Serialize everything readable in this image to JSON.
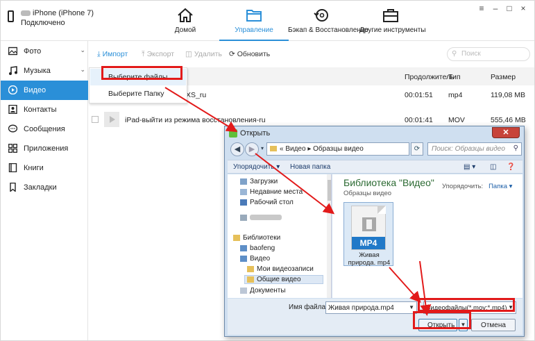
{
  "device": {
    "name": "iPhone (iPhone 7)",
    "status": "Подключено"
  },
  "nav_tabs": [
    {
      "label": "Домой",
      "icon": "home-icon"
    },
    {
      "label": "Управление",
      "icon": "folder-icon",
      "active": true
    },
    {
      "label": "Бэкап & Восстановление",
      "icon": "backup-icon"
    },
    {
      "label": "Другие инструменты",
      "icon": "toolbox-icon"
    }
  ],
  "window_controls": [
    "≡",
    "–",
    "□",
    "×"
  ],
  "sidebar": {
    "items": [
      {
        "label": "Фото",
        "icon": "photo-icon",
        "has_arrow": true
      },
      {
        "label": "Музыка",
        "icon": "music-icon",
        "has_arrow": true
      },
      {
        "label": "Видео",
        "icon": "video-icon",
        "active": true
      },
      {
        "label": "Контакты",
        "icon": "contacts-icon"
      },
      {
        "label": "Сообщения",
        "icon": "messages-icon"
      },
      {
        "label": "Приложения",
        "icon": "apps-icon"
      },
      {
        "label": "Книги",
        "icon": "books-icon"
      },
      {
        "label": "Закладки",
        "icon": "bookmarks-icon"
      }
    ]
  },
  "toolbar": {
    "import": "Импорт",
    "export": "Экспорт",
    "delete": "Удалить",
    "refresh": "Обновить",
    "search_placeholder": "Поиск"
  },
  "table": {
    "headers": {
      "duration": "Продолжитель",
      "type": "Тип",
      "size": "Размер"
    },
    "rows": [
      {
        "name": "XS_ru",
        "duration": "00:01:51",
        "type": "mp4",
        "size": "119,08 MB"
      },
      {
        "name": "iPad-выйти из режима восстановления-ru",
        "duration": "00:01:41",
        "type": "MOV",
        "size": "555,46 MB"
      }
    ]
  },
  "import_menu": {
    "option1": "Выберите файлы",
    "option2": "Выберите Папку"
  },
  "dialog": {
    "title": "Открыть",
    "close": "✕",
    "path": "«  Видео  ▸  Образцы видео",
    "search_placeholder": "Поиск: Образцы видео",
    "organize": "Упорядочить ▾",
    "new_folder": "Новая папка",
    "tree": [
      {
        "label": "Загрузки",
        "icon": "downloads-icon"
      },
      {
        "label": "Недавние места",
        "icon": "recent-places-icon"
      },
      {
        "label": "Рабочий стол",
        "icon": "desktop-icon"
      },
      {
        "label": "Библиотеки",
        "icon": "libraries-icon"
      },
      {
        "label": "baofeng",
        "icon": "library-icon"
      },
      {
        "label": "Видео",
        "icon": "video-library-icon"
      },
      {
        "label": "Мои видеозаписи",
        "icon": "folder-icon"
      },
      {
        "label": "Общие видео",
        "icon": "folder-icon",
        "selected": true
      },
      {
        "label": "Документы",
        "icon": "documents-icon"
      }
    ],
    "library_title": "Библиотека \"Видео\"",
    "library_subtitle": "Образцы видео",
    "arrange_label": "Упорядочить:",
    "arrange_value": "Папка ▾",
    "file": {
      "badge": "MP4",
      "name": "Живая природа. mp4"
    },
    "filename_label": "Имя файла:",
    "filename_value": "Живая природа.mp4",
    "filetype_value": "Видеофайлы(*.mov;*.mp4)",
    "open_button": "Открыть",
    "cancel_button": "Отмена"
  },
  "colors": {
    "accent": "#2a8fd8",
    "annotation_red": "#e21a1a"
  }
}
